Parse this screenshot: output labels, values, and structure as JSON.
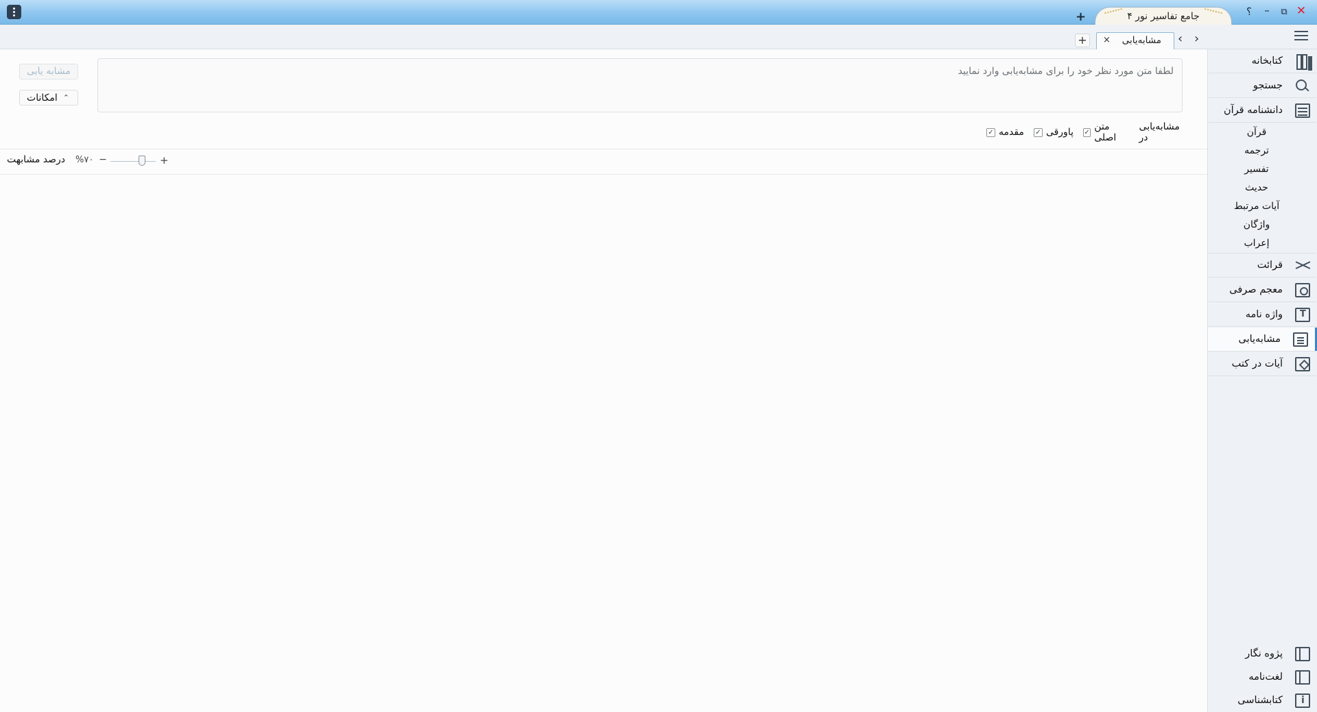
{
  "window": {
    "tab_title": "جامع تفاسیر نور ۴",
    "new_tab": "+",
    "help": "؟",
    "minimize": "–",
    "restore": "⧉",
    "close": "✕"
  },
  "tabs": {
    "active_label": "مشابه‌یابی",
    "close": "×",
    "add": "+",
    "nav_prev": "‹",
    "nav_next": "›"
  },
  "search": {
    "placeholder": "لطفا متن مورد نظر خود را برای مشابه‌یابی وارد نمایید",
    "run_label": "مشابه یابی",
    "options_label": "امکانات",
    "options_chevron": "⌃"
  },
  "filters": {
    "title": "مشابه‌یابی در",
    "items": [
      {
        "label": "متن اصلی",
        "checked": true
      },
      {
        "label": "پاورقی",
        "checked": true
      },
      {
        "label": "مقدمه",
        "checked": true
      }
    ]
  },
  "similarity": {
    "label": "درصد مشابهت",
    "value": "%۷۰",
    "minus": "−",
    "plus": "+",
    "level": 0.7
  },
  "sidebar": {
    "items": [
      {
        "label": "کتابخانه",
        "icon": "library-icon"
      },
      {
        "label": "جستجو",
        "icon": "search-icon"
      },
      {
        "label": "دانشنامه قرآن",
        "icon": "encyclopedia-icon"
      },
      {
        "label": "قرائت",
        "icon": "qiraat-icon"
      },
      {
        "label": "معجم صرفی",
        "icon": "morphology-icon"
      },
      {
        "label": "واژه نامه",
        "icon": "glossary-icon"
      },
      {
        "label": "مشابه‌یابی",
        "icon": "similarity-icon"
      },
      {
        "label": "آیات در کتب",
        "icon": "verses-in-books-icon"
      }
    ],
    "sub_items": [
      "قرآن",
      "ترجمه",
      "تفسیر",
      "حدیث",
      "آیات مرتبط",
      "واژگان",
      "إعراب"
    ],
    "bottom_items": [
      {
        "label": "پژوه نگار",
        "icon": "research-notes-icon"
      },
      {
        "label": "لغت‌نامه",
        "icon": "dictionary-icon"
      },
      {
        "label": "کتابشناسی",
        "icon": "bibliography-icon"
      }
    ]
  }
}
